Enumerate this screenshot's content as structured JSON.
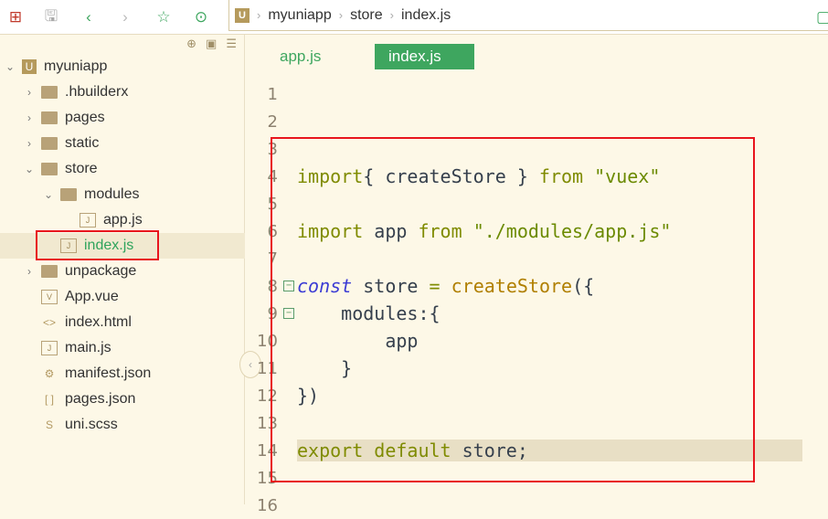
{
  "toolbar": {
    "icons": [
      "new-file-icon",
      "save-icon",
      "back-icon",
      "forward-icon",
      "star-icon",
      "run-icon"
    ],
    "right_icon": "preview-icon"
  },
  "breadcrumb": {
    "logo": "U",
    "items": [
      "myuniapp",
      "store",
      "index.js"
    ]
  },
  "sidebar": {
    "tools": [
      "locate-icon",
      "collapse-icon",
      "menu-icon"
    ],
    "tree": [
      {
        "label": "myuniapp",
        "depth": 0,
        "chev": "open",
        "icon": "project"
      },
      {
        "label": ".hbuilderx",
        "depth": 1,
        "chev": "closed",
        "icon": "folder"
      },
      {
        "label": "pages",
        "depth": 1,
        "chev": "closed",
        "icon": "folder"
      },
      {
        "label": "static",
        "depth": 1,
        "chev": "closed",
        "icon": "folder"
      },
      {
        "label": "store",
        "depth": 1,
        "chev": "open",
        "icon": "folder-open"
      },
      {
        "label": "modules",
        "depth": 2,
        "chev": "open",
        "icon": "folder-open"
      },
      {
        "label": "app.js",
        "depth": 3,
        "chev": "",
        "icon": "js"
      },
      {
        "label": "index.js",
        "depth": 2,
        "chev": "",
        "icon": "js",
        "selected": true
      },
      {
        "label": "unpackage",
        "depth": 1,
        "chev": "closed",
        "icon": "folder"
      },
      {
        "label": "App.vue",
        "depth": 1,
        "chev": "",
        "icon": "vue"
      },
      {
        "label": "index.html",
        "depth": 1,
        "chev": "",
        "icon": "html"
      },
      {
        "label": "main.js",
        "depth": 1,
        "chev": "",
        "icon": "js"
      },
      {
        "label": "manifest.json",
        "depth": 1,
        "chev": "",
        "icon": "gear"
      },
      {
        "label": "pages.json",
        "depth": 1,
        "chev": "",
        "icon": "brackets"
      },
      {
        "label": "uni.scss",
        "depth": 1,
        "chev": "",
        "icon": "scss"
      }
    ]
  },
  "tabs": [
    {
      "label": "app.js",
      "active": false
    },
    {
      "label": "index.js",
      "active": true
    }
  ],
  "colors": {
    "accent": "#3ea65f",
    "highlight_box": "#e8151e",
    "background": "#fdf8e7"
  },
  "code": [
    {
      "n": "1",
      "t": []
    },
    {
      "n": "2",
      "t": []
    },
    {
      "n": "3",
      "t": []
    },
    {
      "n": "4",
      "t": [
        [
          "kw",
          "import"
        ],
        [
          "",
          "{ createStore } "
        ],
        [
          "kw",
          "from"
        ],
        [
          "",
          " "
        ],
        [
          "str",
          "\"vuex\""
        ]
      ]
    },
    {
      "n": "5",
      "t": []
    },
    {
      "n": "6",
      "t": [
        [
          "kw",
          "import"
        ],
        [
          "",
          " app "
        ],
        [
          "kw",
          "from"
        ],
        [
          "",
          " "
        ],
        [
          "str",
          "\"./modules/app.js\""
        ]
      ]
    },
    {
      "n": "7",
      "t": []
    },
    {
      "n": "8",
      "fold": true,
      "t": [
        [
          "blue",
          "const"
        ],
        [
          "",
          " store "
        ],
        [
          "op",
          "="
        ],
        [
          "",
          " "
        ],
        [
          "fn",
          "createStore"
        ],
        [
          "",
          "({"
        ]
      ]
    },
    {
      "n": "9",
      "fold": true,
      "t": [
        [
          "",
          "    modules:{"
        ]
      ]
    },
    {
      "n": "10",
      "t": [
        [
          "",
          "        app"
        ]
      ]
    },
    {
      "n": "11",
      "t": [
        [
          "",
          "    }"
        ]
      ]
    },
    {
      "n": "12",
      "t": [
        [
          "",
          "})"
        ]
      ]
    },
    {
      "n": "13",
      "t": []
    },
    {
      "n": "14",
      "hl": true,
      "t": [
        [
          "kw",
          "export"
        ],
        [
          "",
          " "
        ],
        [
          "kw",
          "default"
        ],
        [
          "",
          " store;"
        ]
      ]
    },
    {
      "n": "15",
      "t": []
    },
    {
      "n": "16",
      "t": []
    }
  ]
}
